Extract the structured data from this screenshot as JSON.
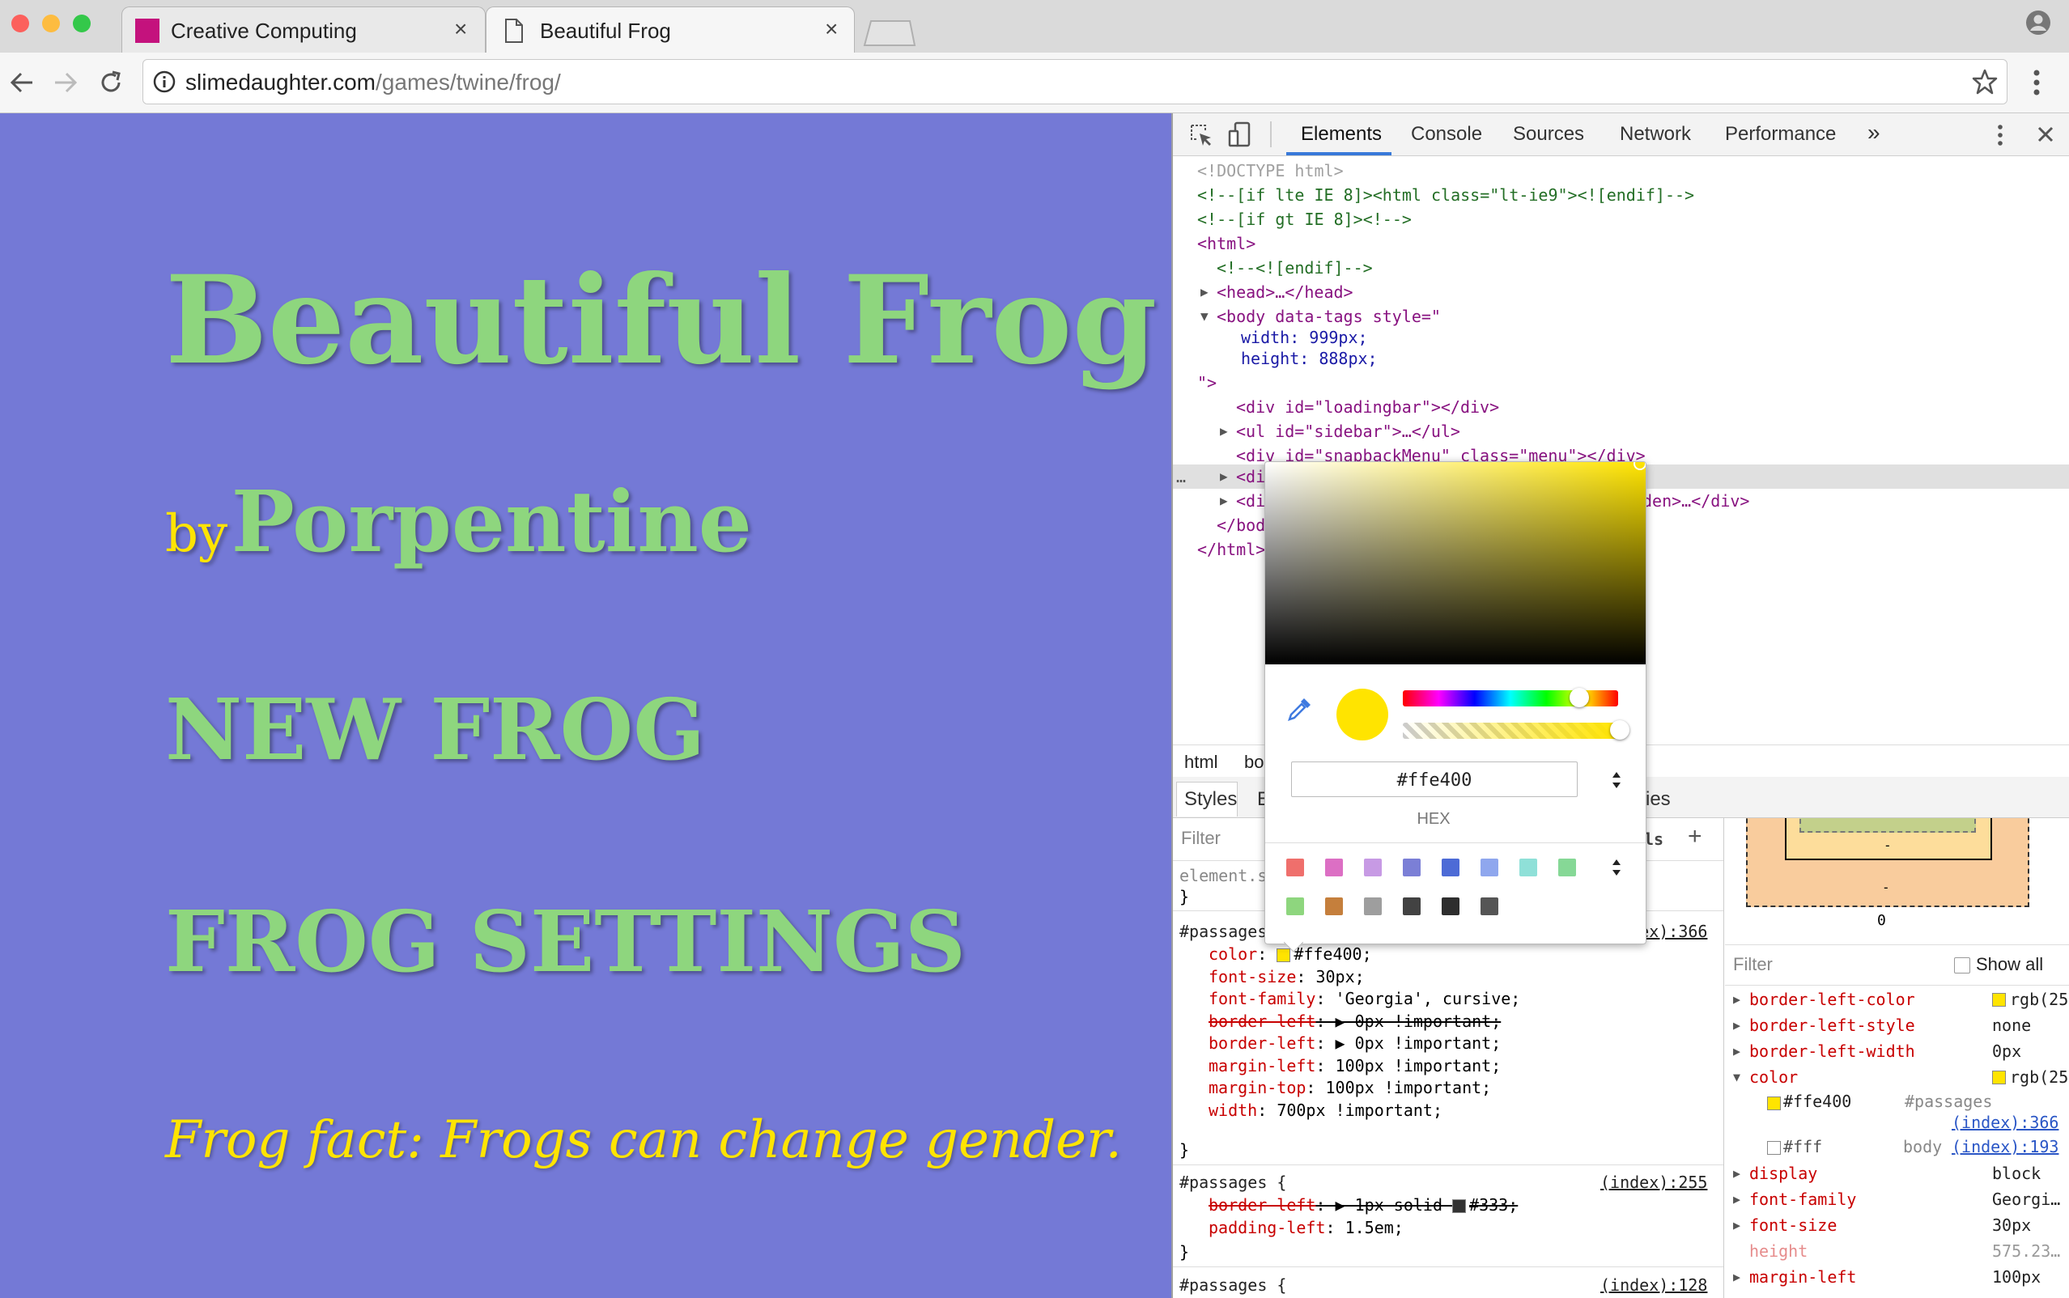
{
  "browser": {
    "tabs": [
      {
        "title": "Creative Computing",
        "close": "×"
      },
      {
        "title": "Beautiful Frog",
        "close": "×"
      }
    ],
    "url_host": "slimedaughter.com",
    "url_path": "/games/twine/frog/"
  },
  "page": {
    "title": "Beautiful Frog",
    "by": "by",
    "author": "Porpentine",
    "links": [
      "NEW FROG",
      "FROG SETTINGS"
    ],
    "fact": "Frog fact: Frogs can change gender."
  },
  "devtools": {
    "tabs": [
      "Elements",
      "Console",
      "Sources",
      "Network",
      "Performance",
      "»"
    ],
    "dom": {
      "doctype": "<!DOCTYPE html>",
      "cond1": "<!--[if lte IE 8]><html class=\"lt-ie9\"><![endif]-->",
      "cond2": "<!--[if gt IE 8]><!-->",
      "html_open": "<html>",
      "endif": "<!--<![endif]-->",
      "head": "<head>…</head>",
      "body_open": "<body data-tags style=\"",
      "width": "width: 999px;",
      "height": "height: 888px;",
      "body_close_attr": "\">",
      "loadingbar": "<div id=\"loadingbar\"></div>",
      "sidebar": "<ul id=\"sidebar\">…</ul>",
      "snapback": "<div id=\"snapbackMenu\" class=\"menu\"></div>",
      "div_sel": "<di",
      "div_hidden_a": "<di",
      "div_hidden_b": "den>…</div>",
      "body_end": "</bod",
      "html_end": "</html>",
      "dots": "…"
    },
    "breadcrumb": [
      "html",
      "bo"
    ],
    "styles_tab": "Styles",
    "styles_tab2": "E",
    "computed_tab_fragment": "ies",
    "filter_placeholder": "Filter",
    "hov_fragment": "ls",
    "add": "+",
    "rules": {
      "element_style": "element.s",
      "close_brace": "}",
      "passages_sel": "#passages",
      "passages_src": "(index):366",
      "decls": [
        {
          "prop": "color",
          "val": "#ffe400;",
          "swatch": "#ffe400",
          "strike": false
        },
        {
          "prop": "font-size",
          "val": "30px;",
          "strike": false
        },
        {
          "prop": "font-family",
          "val": "'Georgia', cursive;",
          "strike": false
        },
        {
          "prop": "border-left",
          "val": "▶ 0px !important;",
          "strike": true
        },
        {
          "prop": "border-left",
          "val": "▶ 0px !important;",
          "strike": false
        },
        {
          "prop": "margin-left",
          "val": "100px !important;",
          "strike": false
        },
        {
          "prop": "margin-top",
          "val": "100px !important;",
          "strike": false
        },
        {
          "prop": "width",
          "val": "700px !important;",
          "strike": false
        }
      ],
      "passages2_sel": "#passages {",
      "passages2_src": "(index):255",
      "decls2": [
        {
          "prop": "border-left",
          "val": "▶ 1px solid ",
          "swatch": "#333333",
          "val2": "#333;",
          "strike": true
        },
        {
          "prop": "padding-left",
          "val": "1.5em;",
          "strike": false
        }
      ],
      "passages3_sel": "#passages {",
      "passages3_src": "(index):128"
    },
    "boxmodel": {
      "dash1": "-",
      "dash2": "-",
      "dash3": "-",
      "bottom": "0"
    },
    "computed": {
      "filter": "Filter",
      "show_all": "Show all",
      "rows": [
        {
          "name": "border-left-color",
          "val": "rgb(25",
          "swatch": "#ffe400",
          "arrow": "▶"
        },
        {
          "name": "border-left-style",
          "val": "none",
          "arrow": "▶"
        },
        {
          "name": "border-left-width",
          "val": "0px",
          "arrow": "▶"
        },
        {
          "name": "color",
          "val": "rgb(25",
          "swatch": "#ffe400",
          "arrow": "▼"
        }
      ],
      "trace1_val": "#ffe400",
      "trace1_sel": "#passages",
      "trace1_src": "(index):366",
      "trace2_val": "#fff",
      "trace2_sel": "body",
      "trace2_src": "(index):193",
      "rows2": [
        {
          "name": "display",
          "val": "block",
          "arrow": "▶"
        },
        {
          "name": "font-family",
          "val": "Georgi…",
          "arrow": "▶"
        },
        {
          "name": "font-size",
          "val": "30px",
          "arrow": "▶"
        },
        {
          "name": "height",
          "val": "575.23…",
          "arrow": ""
        },
        {
          "name": "margin-left",
          "val": "100px",
          "arrow": "▶"
        }
      ]
    },
    "picker": {
      "hex": "#ffe400",
      "format": "HEX",
      "color": "#ffe400",
      "palette_row1": [
        "#ef6f6c",
        "#dc6fc4",
        "#c79ae4",
        "#7b7fd6",
        "#4d6bd6",
        "#8fa7ee",
        "#8fe0d8",
        "#86d896"
      ],
      "palette_row2": [
        "#8ed67e",
        "#c57f3c",
        "#9e9e9e",
        "#424242",
        "#2e2e2e",
        "#555555"
      ]
    }
  }
}
